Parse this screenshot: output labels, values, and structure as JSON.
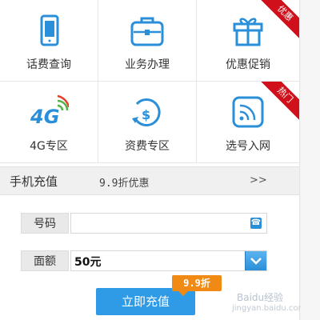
{
  "grid": {
    "items": [
      {
        "label": "话费查询",
        "icon": "phone-bill-icon"
      },
      {
        "label": "业务办理",
        "icon": "briefcase-icon"
      },
      {
        "label": "优惠促销",
        "icon": "gift-icon",
        "badge": "优惠"
      },
      {
        "label": "4G专区",
        "icon": "4g-signal-icon"
      },
      {
        "label": "资费专区",
        "icon": "tariff-refresh-icon"
      },
      {
        "label": "选号入网",
        "icon": "wifi-card-icon",
        "badge": "热门"
      }
    ]
  },
  "recharge": {
    "title": "手机充值",
    "promo": "9.9折优惠",
    "more": ">>",
    "phone_label": "号码",
    "phone_value": "",
    "amount_label": "面额",
    "amount_value": "50元",
    "submit_label": "立即充值",
    "discount_tag": "9.9折"
  },
  "watermark": {
    "text": "Baidu经验",
    "url": "jingyan.baidu.com"
  },
  "colors": {
    "accent_blue": "#2f9ae6",
    "badge_red": "#d0101a",
    "discount_orange": "#f08a14",
    "icon_green": "#52b34a"
  }
}
